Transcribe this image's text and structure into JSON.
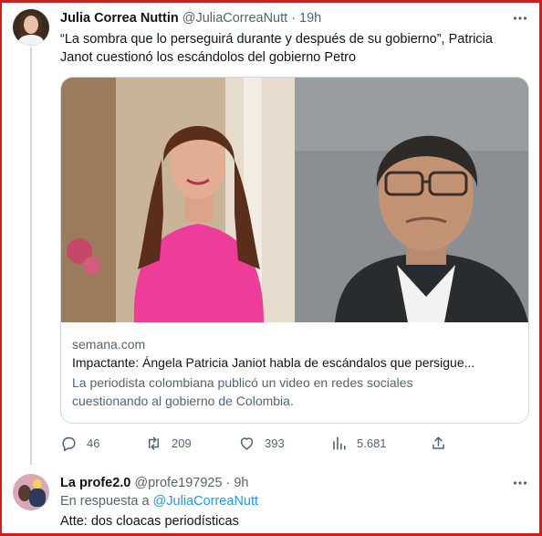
{
  "tweet": {
    "author_name": "Julia Correa Nuttin",
    "author_handle": "@JuliaCorreaNutt",
    "separator": "·",
    "time": "19h",
    "text_line1": "“La sombra que lo perseguirá durante y después de su gobierno”, Patricia",
    "text_line2": "Janot cuestionó los escándolos del gobierno Petro",
    "card": {
      "domain": "semana.com",
      "title": "Impactante: Ángela Patricia Janiot habla de escándalos que persigue...",
      "desc_line1": "La periodista colombiana publicó un video en redes sociales",
      "desc_line2": "cuestionando al gobierno de Colombia."
    },
    "actions": {
      "replies": "46",
      "retweets": "209",
      "likes": "393",
      "views": "5.681"
    },
    "icons": [
      "more-icon",
      "reply-icon",
      "retweet-icon",
      "like-icon",
      "views-icon",
      "share-icon"
    ]
  },
  "reply": {
    "author_name": "La profe2.0",
    "author_handle": "@profe197925",
    "separator": "·",
    "time": "9h",
    "reply_prefix": "En respuesta a",
    "reply_mention": "@JuliaCorreaNutt",
    "text": "Atte: dos cloacas periodísticas"
  },
  "colors": {
    "text_primary": "#0f1419",
    "text_secondary": "#536471",
    "link": "#1d9bf0",
    "border": "#cfd9de",
    "frame": "#cc1f1f"
  }
}
